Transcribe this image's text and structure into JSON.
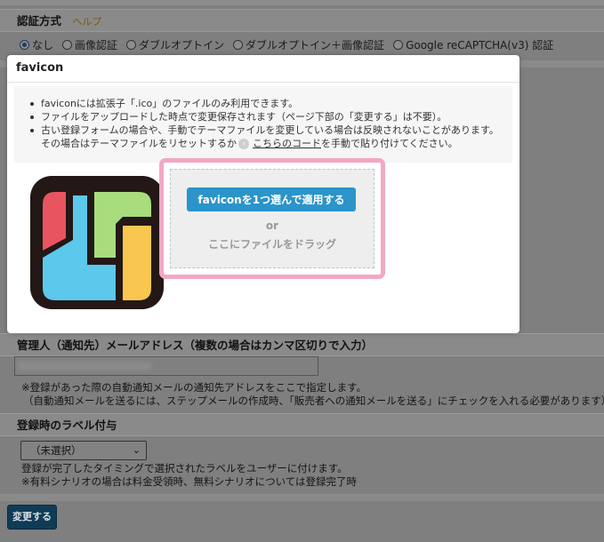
{
  "background": {
    "auth_section": {
      "title": "認証方式",
      "help": "ヘルプ"
    },
    "auth_options": [
      {
        "label": "なし",
        "selected": true
      },
      {
        "label": "画像認証",
        "selected": false
      },
      {
        "label": "ダブルオプトイン",
        "selected": false
      },
      {
        "label": "ダブルオプトイン＋画像認証",
        "selected": false
      },
      {
        "label": "Google reCAPTCHA(v3) 認証",
        "selected": false
      }
    ],
    "admin_email": {
      "title": "管理人（通知先）メールアドレス（複数の場合はカンマ区切りで入力）",
      "note1": "※登録があった際の自動通知メールの通知先アドレスをここで指定します。",
      "note2": "（自動通知メールを送るには、ステップメールの作成時、「販売者への通知メールを送る」にチェックを入れる必要があります）"
    },
    "label_section": {
      "title": "登録時のラベル付与",
      "select_value": "（未選択）",
      "note1": "登録が完了したタイミングで選択されたラベルをユーザーに付けます。",
      "note2": "※有料シナリオの場合は料金受領時、無料シナリオについては登録完了時"
    },
    "submit_label": "変更する"
  },
  "modal": {
    "title": "favicon",
    "notes": [
      "faviconには拡張子「.ico」のファイルのみ利用できます。",
      "ファイルをアップロードした時点で変更保存されます（ページ下部の「変更する」は不要）。",
      "古い登録フォームの場合や、手動でテーマファイルを変更している場合は反映されないことがあります。"
    ],
    "note_continuation_pre": "その場合はテーマファイルをリセットするか",
    "note_link": "こちらのコード",
    "note_continuation_post": "を手動で貼り付けてください。",
    "dropzone": {
      "button_label": "faviconを1つ選んで適用する",
      "or_text": "or",
      "hint": "ここにファイルをドラッグ"
    }
  },
  "colors": {
    "accent": "#2b94c9",
    "highlight_border": "#f3a7c5",
    "overlay": "#7f7f7f"
  }
}
